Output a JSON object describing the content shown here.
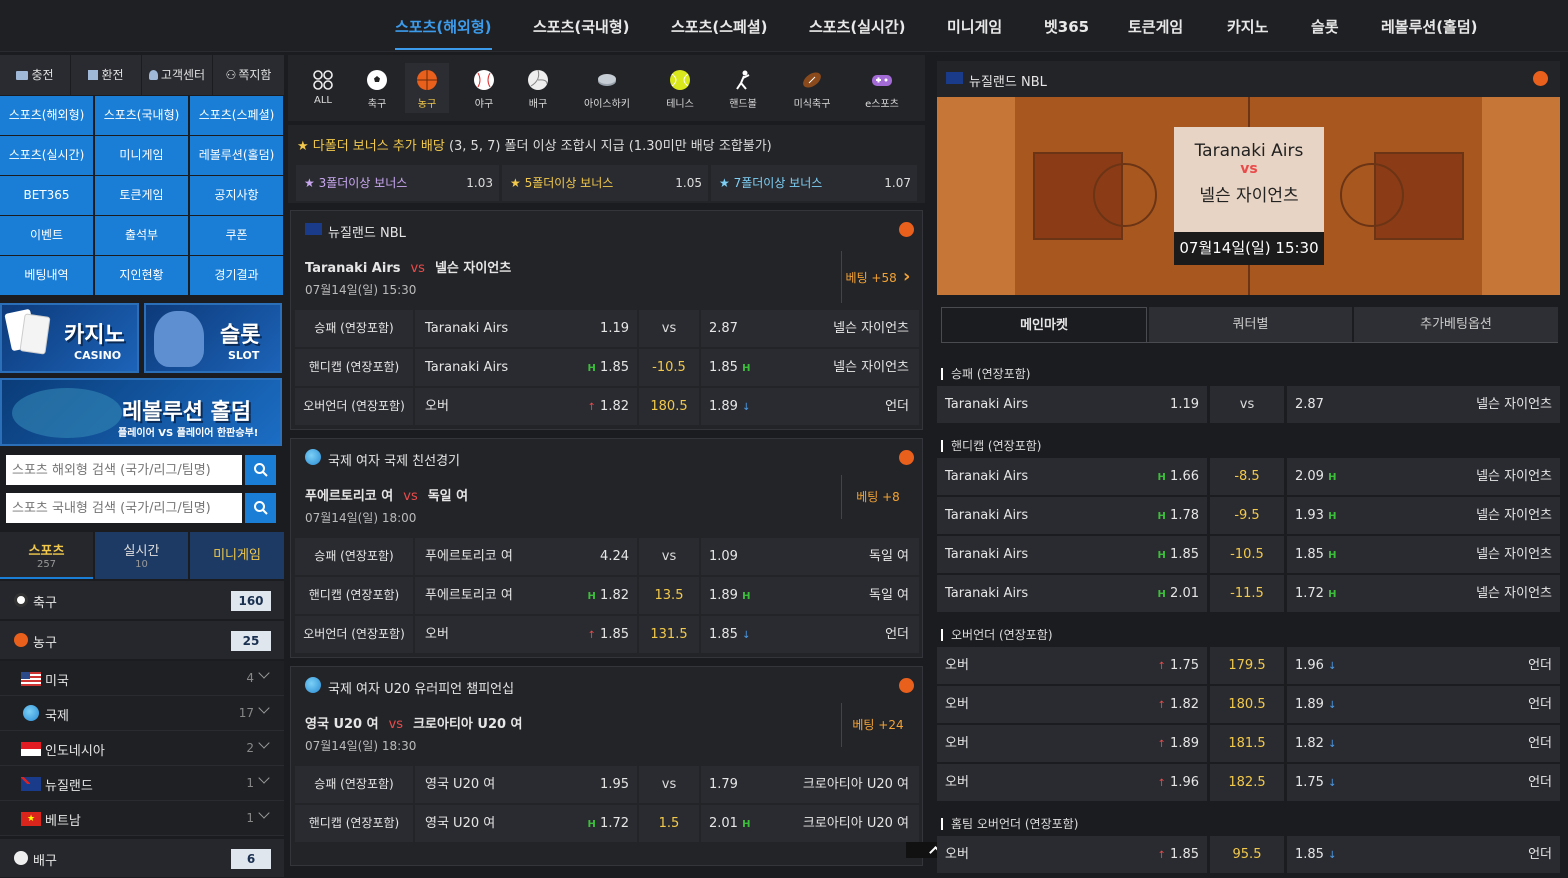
{
  "topnav": [
    "스포츠(해외형)",
    "스포츠(국내형)",
    "스포츠(스페셜)",
    "스포츠(실시간)",
    "미니게임",
    "벳365",
    "토큰게임",
    "카지노",
    "슬롯",
    "레볼루션(홀덤)"
  ],
  "util": [
    "충전",
    "환전",
    "고객센터",
    "쪽지함"
  ],
  "menu": [
    "스포츠(해외형)",
    "스포츠(국내형)",
    "스포츠(스페셜)",
    "스포츠(실시간)",
    "미니게임",
    "레볼루션(홀덤)",
    "BET365",
    "토큰게임",
    "공지사항",
    "이벤트",
    "출석부",
    "쿠폰",
    "베팅내역",
    "지인현황",
    "경기결과"
  ],
  "banners": {
    "casino": "카지노",
    "casino_sub": "CASINO",
    "slot": "슬롯",
    "slot_sub": "SLOT",
    "holdem": "레볼루션 홀덤",
    "holdem_sub": "플레이어 VS 플레이어 한판승부!"
  },
  "search": {
    "foreign_placeholder": "스포츠 해외형 검색 (국가/리그/팀명)",
    "domestic_placeholder": "스포츠 국내형 검색 (국가/리그/팀명)"
  },
  "left_tabs": [
    {
      "label": "스포츠",
      "count": "257"
    },
    {
      "label": "실시간",
      "count": "10"
    },
    {
      "label": "미니게임",
      "count": ""
    }
  ],
  "sports": [
    {
      "name": "축구",
      "count": "160"
    },
    {
      "name": "농구",
      "count": "25"
    },
    {
      "name": "배구",
      "count": "6"
    }
  ],
  "countries": [
    {
      "name": "미국",
      "count": "4"
    },
    {
      "name": "국제",
      "count": "17"
    },
    {
      "name": "인도네시아",
      "count": "2"
    },
    {
      "name": "뉴질랜드",
      "count": "1"
    },
    {
      "name": "베트남",
      "count": "1"
    }
  ],
  "sport_icons": [
    "ALL",
    "축구",
    "농구",
    "야구",
    "배구",
    "아이스하키",
    "테니스",
    "핸드볼",
    "미식축구",
    "e스포츠"
  ],
  "bonus": {
    "title": "★ 다폴더 보너스 추가 배당",
    "desc": "(3, 5, 7) 폴더 이상 조합시 지급 (1.30미만 배당 조합불가)",
    "items": [
      {
        "label": "★ 3폴더이상 보너스",
        "value": "1.03"
      },
      {
        "label": "★ 5폴더이상 보너스",
        "value": "1.05"
      },
      {
        "label": "★ 7폴더이상 보너스",
        "value": "1.07"
      }
    ]
  },
  "matches": [
    {
      "league": "뉴질랜드 NBL",
      "home": "Taranaki Airs",
      "away": "넬슨 자이언츠",
      "vs": "vs",
      "date": "07월14일(일) 15:30",
      "bet": "베팅 +58",
      "rows": [
        {
          "label": "승패 (연장포함)",
          "home": "Taranaki Airs",
          "ho": "1.19",
          "mid": "vs",
          "ao": "2.87",
          "away": "넬슨 자이언츠",
          "type": "wl"
        },
        {
          "label": "핸디캡 (연장포함)",
          "home": "Taranaki Airs",
          "ho": "1.85",
          "mid": "-10.5",
          "ao": "1.85",
          "away": "넬슨 자이언츠",
          "type": "h"
        },
        {
          "label": "오버언더 (연장포함)",
          "home": "오버",
          "ho": "1.82",
          "mid": "180.5",
          "ao": "1.89",
          "away": "언더",
          "type": "ou"
        }
      ]
    },
    {
      "league": "국제 여자 국제 친선경기",
      "home": "푸에르토리코 여",
      "away": "독일 여",
      "vs": "vs",
      "date": "07월14일(일) 18:00",
      "bet": "베팅 +8",
      "rows": [
        {
          "label": "승패 (연장포함)",
          "home": "푸에르토리코 여",
          "ho": "4.24",
          "mid": "vs",
          "ao": "1.09",
          "away": "독일 여",
          "type": "wl"
        },
        {
          "label": "핸디캡 (연장포함)",
          "home": "푸에르토리코 여",
          "ho": "1.82",
          "mid": "13.5",
          "ao": "1.89",
          "away": "독일 여",
          "type": "h"
        },
        {
          "label": "오버언더 (연장포함)",
          "home": "오버",
          "ho": "1.85",
          "mid": "131.5",
          "ao": "1.85",
          "away": "언더",
          "type": "ou"
        }
      ]
    },
    {
      "league": "국제 여자 U20 유러피언 챔피언십",
      "home": "영국 U20 여",
      "away": "크로아티아 U20 여",
      "vs": "vs",
      "date": "07월14일(일) 18:30",
      "bet": "베팅 +24",
      "rows": [
        {
          "label": "승패 (연장포함)",
          "home": "영국 U20 여",
          "ho": "1.95",
          "mid": "vs",
          "ao": "1.79",
          "away": "크로아티아 U20 여",
          "type": "wl"
        },
        {
          "label": "핸디캡 (연장포함)",
          "home": "영국 U20 여",
          "ho": "1.72",
          "mid": "1.5",
          "ao": "2.01",
          "away": "크로아티아 U20 여",
          "type": "h"
        }
      ]
    }
  ],
  "detail": {
    "league": "뉴질랜드 NBL",
    "home": "Taranaki Airs",
    "vs": "vs",
    "away": "넬슨 자이언츠",
    "date": "07월14일(일) 15:30",
    "tabs": [
      "메인마켓",
      "쿼터별",
      "추가베팅옵션"
    ],
    "sections": [
      {
        "title": "승패 (연장포함)",
        "rows": [
          {
            "home": "Taranaki Airs",
            "ho": "1.19",
            "mid": "vs",
            "ao": "2.87",
            "away": "넬슨 자이언츠",
            "type": "wl"
          }
        ]
      },
      {
        "title": "핸디캡 (연장포함)",
        "rows": [
          {
            "home": "Taranaki Airs",
            "ho": "1.66",
            "mid": "-8.5",
            "ao": "2.09",
            "away": "넬슨 자이언츠",
            "type": "h"
          },
          {
            "home": "Taranaki Airs",
            "ho": "1.78",
            "mid": "-9.5",
            "ao": "1.93",
            "away": "넬슨 자이언츠",
            "type": "h"
          },
          {
            "home": "Taranaki Airs",
            "ho": "1.85",
            "mid": "-10.5",
            "ao": "1.85",
            "away": "넬슨 자이언츠",
            "type": "h"
          },
          {
            "home": "Taranaki Airs",
            "ho": "2.01",
            "mid": "-11.5",
            "ao": "1.72",
            "away": "넬슨 자이언츠",
            "type": "h"
          }
        ]
      },
      {
        "title": "오버언더 (연장포함)",
        "rows": [
          {
            "home": "오버",
            "ho": "1.75",
            "mid": "179.5",
            "ao": "1.96",
            "away": "언더",
            "type": "ou"
          },
          {
            "home": "오버",
            "ho": "1.82",
            "mid": "180.5",
            "ao": "1.89",
            "away": "언더",
            "type": "ou"
          },
          {
            "home": "오버",
            "ho": "1.89",
            "mid": "181.5",
            "ao": "1.82",
            "away": "언더",
            "type": "ou"
          },
          {
            "home": "오버",
            "ho": "1.96",
            "mid": "182.5",
            "ao": "1.75",
            "away": "언더",
            "type": "ou"
          }
        ]
      },
      {
        "title": "홈팀 오버언더 (연장포함)",
        "rows": [
          {
            "home": "오버",
            "ho": "1.85",
            "mid": "95.5",
            "ao": "1.85",
            "away": "언더",
            "type": "ou"
          }
        ]
      }
    ]
  },
  "colors": {
    "accent": "#1a7ed6",
    "nav_active": "#3c9bea",
    "odds_label": "#f2c94c",
    "bet_orange": "#f2a234",
    "handicap_h": "#3bbf3b",
    "arrow_up": "#e94b4b",
    "arrow_down": "#4a9be8"
  }
}
